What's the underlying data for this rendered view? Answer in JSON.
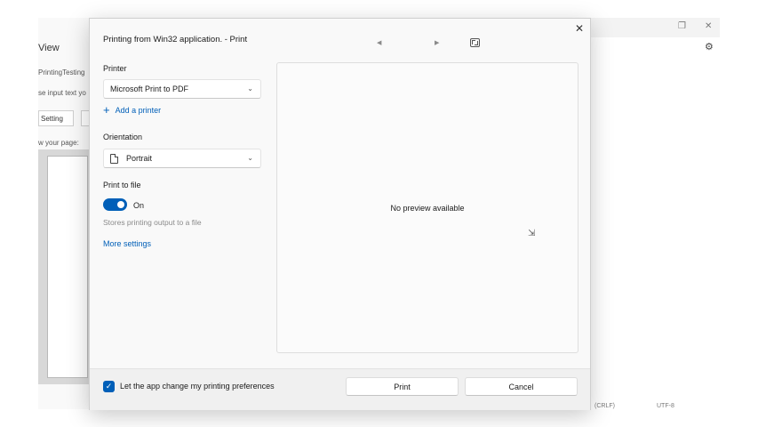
{
  "background_app": {
    "view_title": "View",
    "printing_testing": "PrintingTesting",
    "input_text": "se input text yo",
    "setting_button": "Setting",
    "your_page": "w your page:",
    "status_left": "(CRLF)",
    "status_right": "UTF-8"
  },
  "dialog": {
    "title": "Printing from Win32 application. - Print",
    "printer_label": "Printer",
    "printer_value": "Microsoft Print to PDF",
    "add_printer": "Add a printer",
    "orientation_label": "Orientation",
    "orientation_value": "Portrait",
    "print_to_file_label": "Print to file",
    "toggle_state": "On",
    "helper_text": "Stores printing output to a file",
    "more_settings": "More settings",
    "preview_message": "No preview available",
    "checkbox_label": "Let the app change my printing preferences",
    "print_button": "Print",
    "cancel_button": "Cancel",
    "print_to_file_on": true,
    "let_app_change_checked": true
  },
  "icons": {
    "close": "close-icon",
    "prev": "previous-page-icon",
    "next": "next-page-icon",
    "fit": "fit-to-window-icon",
    "gear": "gear-icon",
    "plus": "plus-icon",
    "document": "document-icon",
    "chevron": "chevron-down-icon",
    "check": "checkmark-icon"
  },
  "colors": {
    "accent": "#005fb8",
    "dialog_bg": "#f9f9f9",
    "footer_bg": "#f0f0f0"
  }
}
